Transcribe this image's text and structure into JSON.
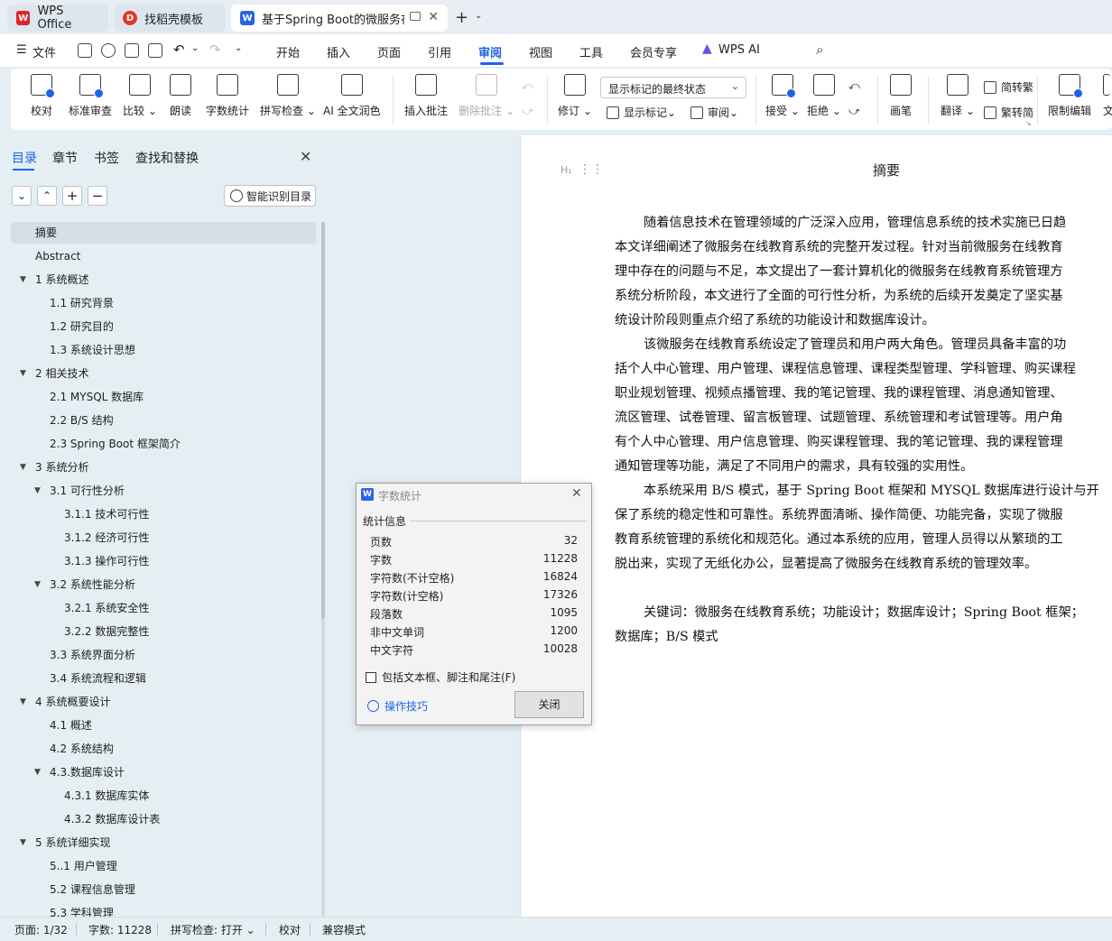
{
  "tabs": [
    {
      "label": "WPS Office",
      "icon": "wps-logo-icon"
    },
    {
      "label": "找稻壳模板",
      "icon": "daoke-logo-icon"
    },
    {
      "label": "基于Spring Boot的微服务在",
      "icon": "wps-writer-icon",
      "active": true
    }
  ],
  "menu": {
    "file": "文件",
    "items": [
      "开始",
      "插入",
      "页面",
      "引用",
      "审阅",
      "视图",
      "工具",
      "会员专享"
    ],
    "active": "审阅",
    "wps_ai": "WPS AI"
  },
  "ribbon": {
    "proofread": "校对",
    "std_review": "标准审查",
    "compare": "比较",
    "read_aloud": "朗读",
    "word_count": "字数统计",
    "spell_check": "拼写检查",
    "ai_polish": "AI 全文润色",
    "insert_comment": "插入批注",
    "delete_comment": "删除批注",
    "revise": "修订",
    "markup_mode": "显示标记的最终状态",
    "show_markup": "显示标记",
    "review": "审阅",
    "accept": "接受",
    "reject": "拒绝",
    "ink": "画笔",
    "translate": "翻译",
    "to_traditional": "简转繁",
    "to_simplified": "繁转简",
    "restrict_edit": "限制编辑",
    "more": "文"
  },
  "nav": {
    "tabs": [
      "目录",
      "章节",
      "书签",
      "查找和替换"
    ],
    "active": "目录",
    "smart_toc": "智能识别目录",
    "toc": [
      {
        "label": "摘要",
        "level": 0,
        "selected": true
      },
      {
        "label": "Abstract",
        "level": 0
      },
      {
        "label": "1 系统概述",
        "level": 0,
        "expanded": true
      },
      {
        "label": "1.1  研究背景",
        "level": 1
      },
      {
        "label": "1.2 研究目的",
        "level": 1
      },
      {
        "label": "1.3 系统设计思想",
        "level": 1
      },
      {
        "label": "2 相关技术",
        "level": 0,
        "expanded": true
      },
      {
        "label": "2.1 MYSQL 数据库",
        "level": 1
      },
      {
        "label": "2.2 B/S 结构",
        "level": 1
      },
      {
        "label": "2.3 Spring Boot 框架简介",
        "level": 1
      },
      {
        "label": "3 系统分析",
        "level": 0,
        "expanded": true
      },
      {
        "label": "3.1 可行性分析",
        "level": 1,
        "expanded": true
      },
      {
        "label": "3.1.1 技术可行性",
        "level": 2
      },
      {
        "label": "3.1.2 经济可行性",
        "level": 2
      },
      {
        "label": "3.1.3 操作可行性",
        "level": 2
      },
      {
        "label": "3.2 系统性能分析",
        "level": 1,
        "expanded": true
      },
      {
        "label": "3.2.1  系统安全性",
        "level": 2
      },
      {
        "label": "3.2.2  数据完整性",
        "level": 2
      },
      {
        "label": "3.3 系统界面分析",
        "level": 1
      },
      {
        "label": "3.4 系统流程和逻辑",
        "level": 1
      },
      {
        "label": "4 系统概要设计",
        "level": 0,
        "expanded": true
      },
      {
        "label": "4.1 概述",
        "level": 1
      },
      {
        "label": "4.2 系统结构",
        "level": 1
      },
      {
        "label": "4.3.数据库设计",
        "level": 1,
        "expanded": true
      },
      {
        "label": "4.3.1 数据库实体",
        "level": 2
      },
      {
        "label": "4.3.2 数据库设计表",
        "level": 2
      },
      {
        "label": "5 系统详细实现",
        "level": 0,
        "expanded": true
      },
      {
        "label": "5..1  用户管理",
        "level": 1
      },
      {
        "label": "5.2  课程信息管理",
        "level": 1
      },
      {
        "label": "5.3  学科管理",
        "level": 1
      }
    ]
  },
  "document": {
    "title": "摘要",
    "lines": [
      "随着信息技术在管理领域的广泛深入应用，管理信息系统的技术实施已日趋",
      "本文详细阐述了微服务在线教育系统的完整开发过程。针对当前微服务在线教育",
      "理中存在的问题与不足，本文提出了一套计算机化的微服务在线教育系统管理方",
      "系统分析阶段，本文进行了全面的可行性分析，为系统的后续开发奠定了坚实基",
      "统设计阶段则重点介绍了系统的功能设计和数据库设计。",
      "该微服务在线教育系统设定了管理员和用户两大角色。管理员具备丰富的功",
      "括个人中心管理、用户管理、课程信息管理、课程类型管理、学科管理、购买课程",
      "职业规划管理、视频点播管理、我的笔记管理、我的课程管理、消息通知管理、",
      "流区管理、试卷管理、留言板管理、试题管理、系统管理和考试管理等。用户角",
      "有个人中心管理、用户信息管理、购买课程管理、我的笔记管理、我的课程管理",
      "通知管理等功能，满足了不同用户的需求，具有较强的实用性。",
      "本系统采用 B/S 模式，基于 Spring Boot 框架和 MYSQL 数据库进行设计与开",
      "保了系统的稳定性和可靠性。系统界面清晰、操作简便、功能完备，实现了微服",
      "教育系统管理的系统化和规范化。通过本系统的应用，管理人员得以从繁琐的工",
      "脱出来，实现了无纸化办公，显著提高了微服务在线教育系统的管理效率。",
      "关键词：微服务在线教育系统；功能设计；数据库设计；Spring Boot 框架；",
      "数据库；B/S 模式"
    ]
  },
  "dialog": {
    "title": "字数统计",
    "group": "统计信息",
    "stats": [
      {
        "label": "页数",
        "value": "32"
      },
      {
        "label": "字数",
        "value": "11228"
      },
      {
        "label": "字符数(不计空格)",
        "value": "16824"
      },
      {
        "label": "字符数(计空格)",
        "value": "17326"
      },
      {
        "label": "段落数",
        "value": "1095"
      },
      {
        "label": "非中文单词",
        "value": "1200"
      },
      {
        "label": "中文字符",
        "value": "10028"
      }
    ],
    "checkbox": "包括文本框、脚注和尾注(F)",
    "tips": "操作技巧",
    "close": "关闭"
  },
  "status": {
    "page": "页面: 1/32",
    "words": "字数: 11228",
    "spell": "拼写检查: 打开",
    "proof": "校对",
    "compat": "兼容模式"
  },
  "colors": {
    "accent": "#1f63e8",
    "wps_red": "#d9262c"
  }
}
